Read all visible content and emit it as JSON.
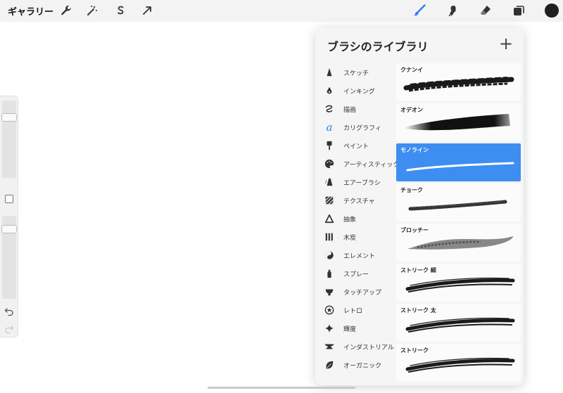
{
  "toolbar": {
    "gallery_label": "ギャラリー",
    "left_icons": [
      "wrench-icon",
      "magic-wand-icon",
      "selection-s-icon",
      "transform-arrow-icon"
    ],
    "right_icons": [
      "brush-icon",
      "smudge-icon",
      "eraser-icon",
      "layers-icon",
      "color-swatch-icon"
    ],
    "accent_color": "#2f7cf6",
    "current_color": "#1f1f1f"
  },
  "sidebar": {
    "brush_size_level": 0.18,
    "opacity_level": 0.12,
    "undo_icon": "undo-icon",
    "redo_icon": "redo-icon"
  },
  "panel": {
    "title": "ブラシのライブラリ",
    "add_label": "+",
    "categories": [
      {
        "label": "スケッチ",
        "icon": "pencil-tip-icon"
      },
      {
        "label": "インキング",
        "icon": "ink-drop-icon"
      },
      {
        "label": "描画",
        "icon": "squiggle-icon"
      },
      {
        "label": "カリグラフィ",
        "icon": "calligraphy-a-icon"
      },
      {
        "label": "ペイント",
        "icon": "paint-brush-icon"
      },
      {
        "label": "アーティスティック",
        "icon": "palette-icon"
      },
      {
        "label": "エアーブラシ",
        "icon": "airbrush-icon"
      },
      {
        "label": "テクスチャ",
        "icon": "texture-icon"
      },
      {
        "label": "抽象",
        "icon": "triangle-icon"
      },
      {
        "label": "木炭",
        "icon": "charcoal-icon"
      },
      {
        "label": "エレメント",
        "icon": "element-yin-yang-icon"
      },
      {
        "label": "スプレー",
        "icon": "spray-can-icon"
      },
      {
        "label": "タッチアップ",
        "icon": "touchup-icon"
      },
      {
        "label": "レトロ",
        "icon": "retro-star-icon"
      },
      {
        "label": "輝度",
        "icon": "sparkle-icon"
      },
      {
        "label": "インダストリアル",
        "icon": "anvil-icon"
      },
      {
        "label": "オーガニック",
        "icon": "leaf-icon"
      }
    ],
    "brushes": [
      {
        "name": "クナンイ",
        "selected": false,
        "style": "rough"
      },
      {
        "name": "オデオン",
        "selected": false,
        "style": "wedge"
      },
      {
        "name": "モノライン",
        "selected": true,
        "style": "mono"
      },
      {
        "name": "チョーク",
        "selected": false,
        "style": "chalk"
      },
      {
        "name": "ブロッチー",
        "selected": false,
        "style": "blotch"
      },
      {
        "name": "ストリーク 細",
        "selected": false,
        "style": "streak",
        "edited": true
      },
      {
        "name": "ストリーク 太",
        "selected": false,
        "style": "streak",
        "edited": true
      },
      {
        "name": "ストリーク",
        "selected": false,
        "style": "streak",
        "edited": false
      }
    ]
  }
}
